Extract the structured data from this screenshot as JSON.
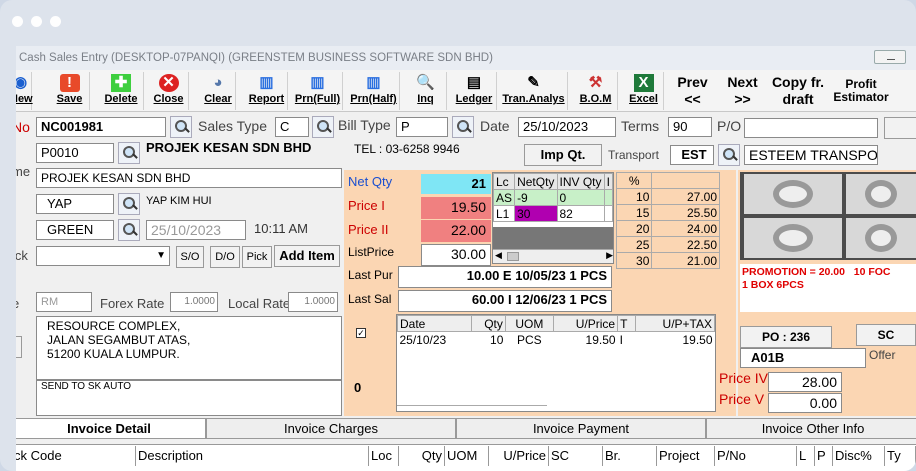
{
  "window": {
    "title": "Cash Sales Entry    (DESKTOP-07PANQI)    (GREENSTEM BUSINESS SOFTWARE SDN BHD)"
  },
  "toolbar": {
    "new": "New",
    "save": "Save",
    "delete": "Delete",
    "close": "Close",
    "clear": "Clear",
    "report": "Report",
    "prn_full": "Prn(Full)",
    "prn_half": "Prn(Half)",
    "inq": "Inq",
    "ledger": "Ledger",
    "tran_analys": "Tran.Analys",
    "bom": "B.O.M",
    "excel": "Excel",
    "prev": "Prev",
    "prev_sym": "<<",
    "next": "Next",
    "next_sym": ">>",
    "copy": "Copy fr.",
    "copy2": "draft",
    "profit": "Profit",
    "profit2": "Estimator"
  },
  "header": {
    "no_label": "No",
    "no_value": "NC001981",
    "sales_type_label": "Sales Type",
    "sales_type_value": "C",
    "bill_type_label": "Bill Type",
    "bill_type_value": "P",
    "date_label": "Date",
    "date_value": "25/10/2023",
    "terms_label": "Terms",
    "terms_value": "90",
    "po_label": "P/O",
    "po_value": "",
    "customer_code": "P0010",
    "customer_name": "PROJEK KESAN SDN BHD",
    "tel": "TEL : 03-6258 9946",
    "imp_qt": "Imp Qt.",
    "transport_label": "Transport",
    "transport_code": "EST",
    "transport_name": "ESTEEM TRANSPOR",
    "name_label": "me",
    "name_value": "PROJEK KESAN SDN BHD",
    "agent_code": "YAP",
    "agent_name": "YAP KIM HUI",
    "area_code": "GREEN",
    "date2": "25/10/2023",
    "time": "10:11 AM",
    "pick_label": "ick",
    "so": "S/O",
    "do": "D/O",
    "pick": "Pick",
    "add_item": "Add Item",
    "currency": "RM",
    "forex_label": "Forex Rate",
    "forex_value": "1.0000",
    "local_label": "Local Rate",
    "local_value": "1.0000",
    "address": "RESOURCE COMPLEX,\nJALAN SEGAMBUT ATAS,\n51200 KUALA LUMPUR.",
    "remark": "SEND TO SK AUTO",
    "e_label": "e"
  },
  "pricing": {
    "net_qty_label": "Net Qty",
    "net_qty": "21",
    "price1_label": "Price I",
    "price1": "19.50",
    "price2_label": "Price II",
    "price2": "22.00",
    "list_label": "ListPrice",
    "list_value": "30.00",
    "last_pur_label": "Last Pur",
    "last_pur": "10.00  E   10/05/23   1   PCS",
    "last_sal_label": "Last Sal",
    "last_sal": "60.00  I   12/06/23   1   PCS",
    "count": "0"
  },
  "loc_table": {
    "headers": [
      "Lc",
      "NetQty",
      "INV Qty",
      "I"
    ],
    "rows": [
      [
        "AS",
        "-9",
        "0",
        ""
      ],
      [
        "L1",
        "30",
        "82",
        ""
      ]
    ]
  },
  "disc_table": {
    "header": "%",
    "rows": [
      [
        "10",
        "27.00"
      ],
      [
        "15",
        "25.50"
      ],
      [
        "20",
        "24.00"
      ],
      [
        "25",
        "22.50"
      ],
      [
        "30",
        "21.00"
      ]
    ]
  },
  "history": {
    "headers": [
      "Date",
      "Qty",
      "UOM",
      "U/Price",
      "T",
      "U/P+TAX"
    ],
    "rows": [
      [
        "25/10/23",
        "10",
        "PCS",
        "19.50",
        "I",
        "19.50"
      ]
    ]
  },
  "promo": "PROMOTION = 20.00   10 FOC\n1 BOX 6PCS",
  "po_box": "PO :  236",
  "sc": "SC",
  "offer": "Offer",
  "item_code": "A01B",
  "price4_label": "Price IV",
  "price4": "28.00",
  "price5_label": "Price V",
  "price5": "0.00",
  "tabs": [
    "Invoice Detail",
    "Invoice Charges",
    "Invoice Payment",
    "Invoice Other Info"
  ],
  "columns": [
    "ck Code",
    "Description",
    "Loc",
    "Qty",
    "UOM",
    "U/Price",
    "SC",
    "Br.",
    "Project",
    "P/No",
    "L",
    "P",
    "Disc%",
    "Ty"
  ],
  "colors": {
    "net_qty_bg": "#7fe6f5",
    "price_bg": "#f08080",
    "purple": "#b000b0",
    "promo": "#e00000"
  }
}
